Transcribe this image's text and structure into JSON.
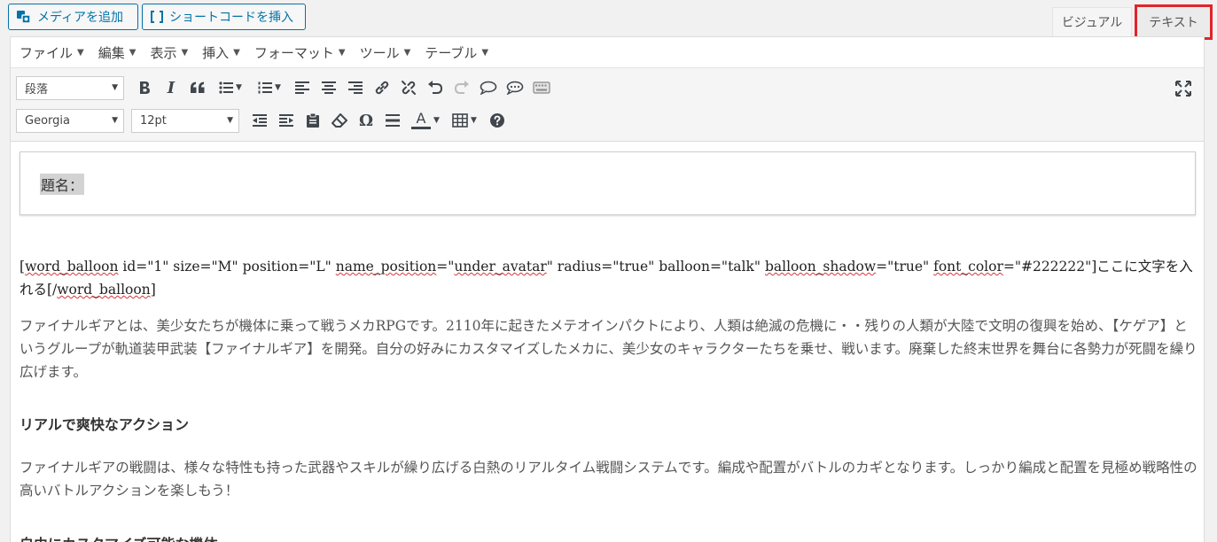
{
  "top_buttons": {
    "add_media": "メディアを追加",
    "insert_shortcode": "ショートコードを挿入"
  },
  "mode_tabs": {
    "visual": "ビジュアル",
    "text": "テキスト"
  },
  "menubar": [
    {
      "label": "ファイル",
      "icon": "chevron-down-icon"
    },
    {
      "label": "編集",
      "icon": "chevron-down-icon"
    },
    {
      "label": "表示",
      "icon": "chevron-down-icon"
    },
    {
      "label": "挿入",
      "icon": "chevron-down-icon"
    },
    {
      "label": "フォーマット",
      "icon": "chevron-down-icon"
    },
    {
      "label": "ツール",
      "icon": "chevron-down-icon"
    },
    {
      "label": "テーブル",
      "icon": "chevron-down-icon"
    }
  ],
  "toolbar": {
    "block_format": "段落",
    "font_family": "Georgia",
    "font_size": "12pt",
    "italic_glyph": "I",
    "omega_glyph": "Ω",
    "text_color_glyph": "A"
  },
  "content": {
    "title_label": "題名：",
    "shortcode": {
      "p1": "[",
      "p2": "word_balloon",
      "p3": " id=\"1\" size=\"M\" position=\"L\" ",
      "p4": "name_position",
      "p5": "=\"",
      "p6": "under_avatar",
      "p7": "\" radius=\"true\" balloon=\"talk\" ",
      "p8": "balloon_shadow",
      "p9": "=\"true\" ",
      "p10": "font_color",
      "p11": "=\"#222222\"]ここに文字を入れる[/",
      "p12": "word_balloon",
      "p13": "]"
    },
    "intro": "ファイナルギアとは、美少女たちが機体に乗って戦うメカRPGです。2110年に起きたメテオインパクトにより、人類は絶滅の危機に・・残りの人類が大陸で文明の復興を始め、【ケゲア】というグループが軌道装甲武装【ファイナルギア】を開発。自分の好みにカスタマイズしたメカに、美少女のキャラクターたちを乗せ、戦います。廃棄した終末世界を舞台に各勢力が死闘を繰り広げます。",
    "heading1": "リアルで爽快なアクション",
    "body1": "ファイナルギアの戦闘は、様々な特性も持った武器やスキルが繰り広げる白熱のリアルタイム戦闘システムです。編成や配置がバトルのカギとなります。しっかり編成と配置を見極め戦略性の高いバトルアクションを楽しもう！",
    "heading2": "自由にカスタマイズ可能な機体"
  },
  "colors": {
    "accent": "#0073aa",
    "highlight_border": "#e0242b",
    "spellcheck": "#d63638"
  }
}
